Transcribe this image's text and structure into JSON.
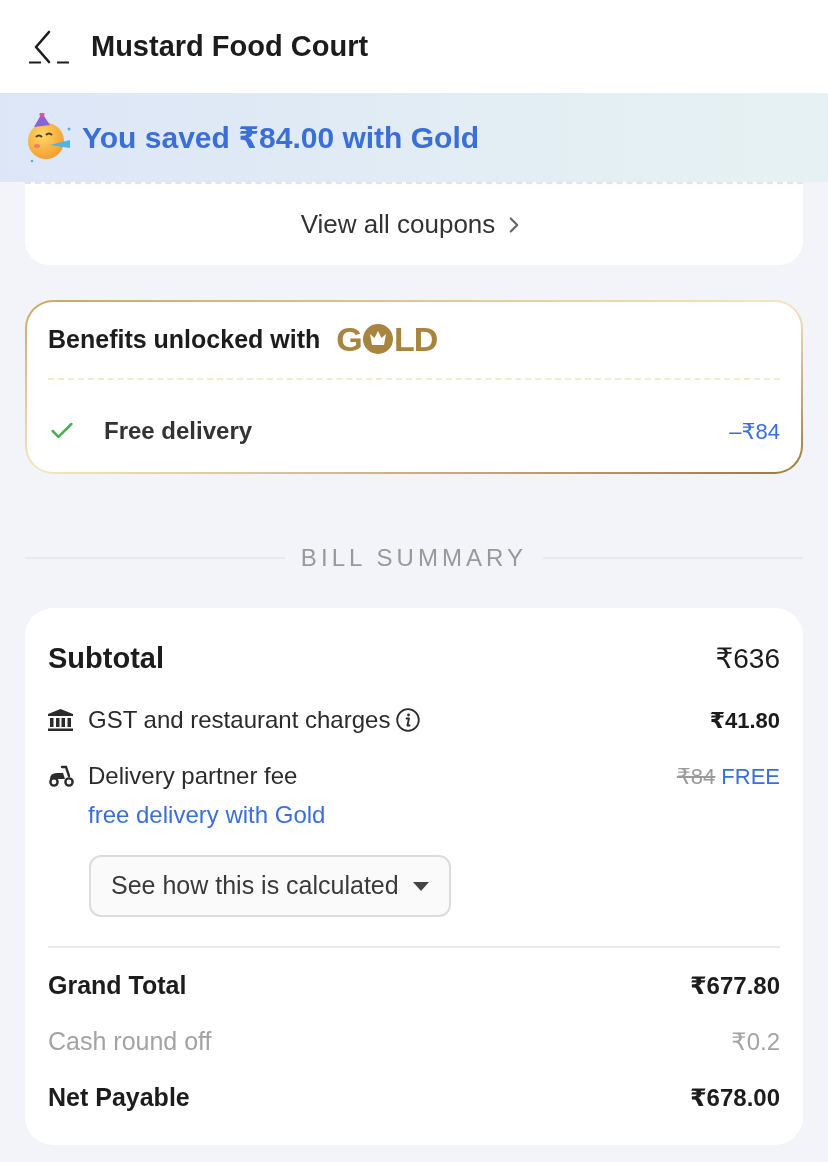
{
  "header": {
    "title": "Mustard Food Court"
  },
  "savings_banner": {
    "text": "You saved ₹84.00 with Gold"
  },
  "coupons": {
    "link": "View all coupons"
  },
  "gold_benefits": {
    "title": "Benefits unlocked with",
    "logo": {
      "lead": "G",
      "tail": "LD"
    },
    "items": [
      {
        "label": "Free delivery",
        "amount": "–₹84",
        "checked": true
      }
    ]
  },
  "bill_summary": {
    "heading": "BILL SUMMARY",
    "subtotal": {
      "label": "Subtotal",
      "amount": "₹636"
    },
    "charges": [
      {
        "kind": "tax",
        "label": "GST and restaurant charges",
        "info": true,
        "amount": "₹41.80"
      },
      {
        "kind": "delivery",
        "label": "Delivery partner fee",
        "info": false,
        "original_amount": "₹84",
        "amount": "FREE",
        "note": "free delivery with Gold"
      }
    ],
    "calculation_button": {
      "label": "See how this is calculated",
      "expanded": false
    },
    "totals": [
      {
        "kind": "total",
        "label": "Grand Total",
        "amount": "₹677.80"
      },
      {
        "kind": "muted",
        "label": "Cash round off",
        "amount": "₹0.2"
      },
      {
        "kind": "total",
        "label": "Net Payable",
        "amount": "₹678.00"
      }
    ]
  }
}
